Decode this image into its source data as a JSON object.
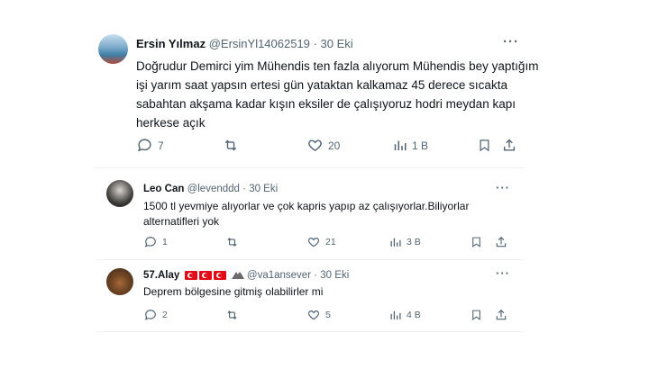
{
  "main_tweet": {
    "author_name": "Ersin Yılmaz",
    "handle": "@ErsinYl14062519",
    "separator": "·",
    "date": "30 Eki",
    "text_lines": [
      "Doğrudur Demirci yim Mühendis ten fazla alıyorum Mühendis bey yaptığım",
      "işi yarım saat yapsın ertesi gün yataktan kalkamaz 45 derece sıcakta",
      "sabahtan akşama kadar kışın eksiler de çalışıyoruz hodri meydan kapı",
      "herkese açık"
    ],
    "replies": "7",
    "likes": "20",
    "views": "1 B"
  },
  "reply1": {
    "author_name": "Leo Can",
    "handle": "@levenddd",
    "separator": "·",
    "date": "30 Eki",
    "text_lines": [
      "1500 tl yevmiye alıyorlar ve çok kapris yapıp az çalışıyorlar.Biliyorlar",
      "alternatifleri yok"
    ],
    "replies": "1",
    "likes": "21",
    "views": "3 B"
  },
  "reply2": {
    "author_name": "57.Alay",
    "handle": "@va1ansever",
    "separator": "·",
    "date": "30 Eki",
    "text_lines": [
      "Deprem bölgesine gitmiş olabilirler mi"
    ],
    "replies": "2",
    "likes": "5",
    "views": "4 B"
  },
  "icons": {
    "more": "···"
  }
}
